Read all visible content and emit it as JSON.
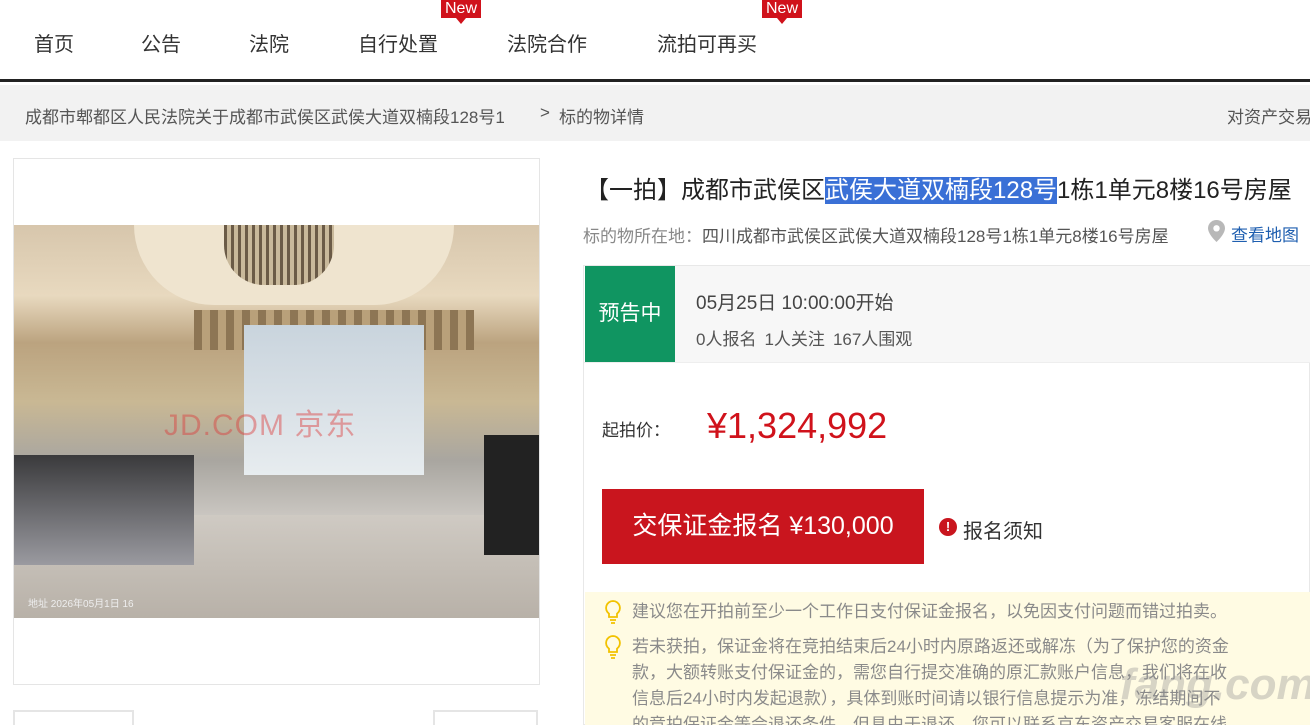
{
  "nav": {
    "items": [
      {
        "label": "首页"
      },
      {
        "label": "公告"
      },
      {
        "label": "法院"
      },
      {
        "label": "自行处置",
        "badge": "New"
      },
      {
        "label": "法院合作"
      },
      {
        "label": "流拍可再买",
        "badge": "New"
      }
    ]
  },
  "breadcrumb": {
    "item1": "成都市郫都区人民法院关于成都市武侯区武侯大道双楠段128号1",
    "separator": ">",
    "item2": "标的物详情",
    "right_text": "对资产交易"
  },
  "gallery": {
    "watermark": "JD.COM 京东",
    "photo_stamp": "地址 2026年05月1日 16"
  },
  "detail": {
    "title_prefix": "【一拍】成都市武侯区",
    "title_highlight": "武侯大道双楠段128号",
    "title_suffix": "1栋1单元8楼16号房屋",
    "location_label": "标的物所在地：",
    "location_value": "四川成都市武侯区武侯大道双楠段128号1栋1单元8楼16号房屋",
    "map_link": "查看地图",
    "status": "预告中",
    "start_time": "05月25日 10:00:00开始",
    "stats": {
      "signups": "0人报名",
      "follows": "1人关注",
      "views": "167人围观"
    },
    "price_label": "起拍价：",
    "price_value": "¥1,324,992",
    "deposit_button": "交保证金报名 ¥130,000",
    "notice_link": "报名须知",
    "tips": [
      "建议您在开拍前至少一个工作日支付保证金报名，以免因支付问题而错过拍卖。",
      "若未获拍，保证金将在竞拍结束后24小时内原路返还或解冻（为了保护您的资金",
      "款，大额转账支付保证金的，需您自行提交准确的原汇款账户信息，我们将在收",
      "信息后24小时内发起退款），具体到账时间请以银行信息提示为准，冻结期间不",
      "的竞拍保证金等会退还条件，但具由于退还，您可以联系京东资产交易客服在线"
    ]
  },
  "watermark_site": "fang.com",
  "colors": {
    "accent_red": "#c9151e",
    "status_green": "#109561",
    "price_red": "#d0121b",
    "link_blue": "#1f5fb0",
    "highlight_blue": "#3a70d6",
    "tips_bg": "#fffbe3"
  }
}
